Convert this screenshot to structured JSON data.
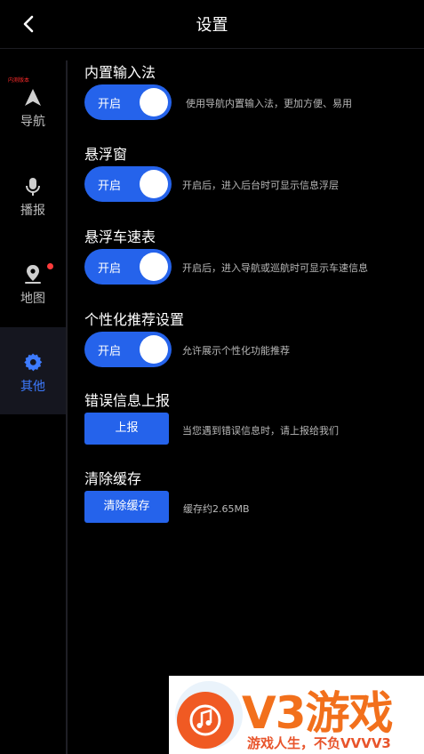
{
  "header": {
    "title": "设置",
    "back_icon": "chevron-left-icon"
  },
  "sidebar": {
    "version_tag": "内测版本",
    "items": [
      {
        "label": "导航",
        "icon": "navigation-arrow-icon",
        "active": false
      },
      {
        "label": "播报",
        "icon": "microphone-icon",
        "active": false
      },
      {
        "label": "地图",
        "icon": "map-pin-icon",
        "active": false,
        "badge": true
      },
      {
        "label": "其他",
        "icon": "gear-icon",
        "active": true
      }
    ]
  },
  "settings": {
    "input_method": {
      "title": "内置输入法",
      "toggle": "开启",
      "desc": "使用导航内置输入法，更加方便、易用"
    },
    "floating_window": {
      "title": "悬浮窗",
      "toggle": "开启",
      "desc": "开启后，进入后台时可显示信息浮层"
    },
    "speedometer": {
      "title": "悬浮车速表",
      "toggle": "开启",
      "desc": "开启后，进入导航或巡航时可显示车速信息"
    },
    "recommend": {
      "title": "个性化推荐设置",
      "toggle": "开启",
      "desc": "允许展示个性化功能推荐"
    },
    "report": {
      "title": "错误信息上报",
      "button": "上报",
      "desc": "当您遇到错误信息时，请上报给我们"
    },
    "cache": {
      "title": "清除缓存",
      "button": "清除缓存",
      "desc": "缓存约2.65MB"
    }
  },
  "ad": {
    "brand": "V3游戏",
    "slogan": "游戏人生，不负VVVV3"
  },
  "colors": {
    "accent": "#2563eb",
    "active_text": "#3d7bff",
    "badge": "#ff3b3b",
    "ad_brand": "#f2701c"
  }
}
